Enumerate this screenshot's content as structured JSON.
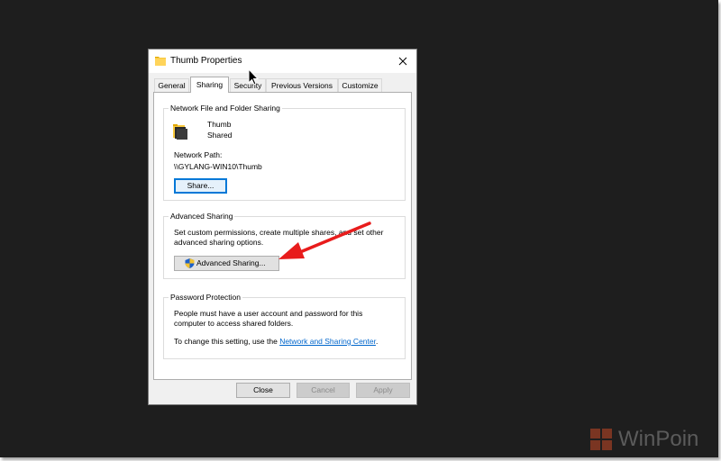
{
  "window": {
    "title": "Thumb Properties",
    "icons": {
      "folder": "folder-icon",
      "close": "close-icon"
    }
  },
  "tabs": [
    {
      "label": "General",
      "active": false
    },
    {
      "label": "Sharing",
      "active": true
    },
    {
      "label": "Security",
      "active": false
    },
    {
      "label": "Previous Versions",
      "active": false
    },
    {
      "label": "Customize",
      "active": false
    }
  ],
  "network_sharing": {
    "title": "Network File and Folder Sharing",
    "folder_name": "Thumb",
    "folder_status": "Shared",
    "path_label": "Network Path:",
    "path_value": "\\\\GYLANG-WIN10\\Thumb",
    "share_button": "Share..."
  },
  "advanced_sharing": {
    "title": "Advanced Sharing",
    "description_line1": "Set custom permissions, create multiple shares, and set other",
    "description_line2": "advanced sharing options.",
    "button_label": "Advanced Sharing...",
    "button_icon": "uac-shield-icon"
  },
  "password_protection": {
    "title": "Password Protection",
    "line1": "People must have a user account and password for this",
    "line2": "computer to access shared folders.",
    "line3_prefix": "To change this setting, use the ",
    "link_text": "Network and Sharing Center",
    "line3_suffix": "."
  },
  "footer": {
    "close": "Close",
    "cancel": "Cancel",
    "apply": "Apply"
  },
  "watermark": {
    "text": "WinPoin"
  },
  "colors": {
    "desktop_bg": "#1e1e1e",
    "dialog_bg": "#f0f0f0",
    "focus_blue": "#0078d7",
    "link_blue": "#0066cc",
    "annotation_red": "#e81c1c"
  }
}
